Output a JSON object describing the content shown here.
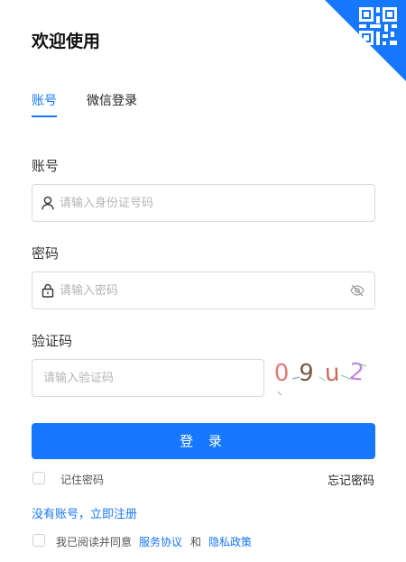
{
  "header": {
    "title": "欢迎使用",
    "qr_icon": "qr-code-icon"
  },
  "tabs": [
    {
      "label": "账号",
      "active": true
    },
    {
      "label": "微信登录",
      "active": false
    }
  ],
  "account": {
    "label": "账号",
    "placeholder": "请输入身份证号码",
    "icon": "user-icon"
  },
  "password": {
    "label": "密码",
    "placeholder": "请输入密码",
    "icon": "lock-icon",
    "toggle_icon": "eye-off-icon"
  },
  "captcha": {
    "label": "验证码",
    "placeholder": "请输入验证码",
    "chars": [
      "0",
      "9",
      "u",
      "2"
    ],
    "colors": [
      "#e07a7a",
      "#7a5a4a",
      "#c86a5a",
      "#c08ae0"
    ]
  },
  "login_button": "登 录",
  "remember": {
    "label": "记住密码",
    "checked": false
  },
  "forgot": "忘记密码",
  "register_link": "没有账号，立即注册",
  "agreement": {
    "prefix": "我已阅读并同意",
    "service": "服务协议",
    "and": "和",
    "privacy": "隐私政策",
    "checked": false
  },
  "colors": {
    "primary": "#1677ff",
    "border": "#d9d9d9"
  }
}
